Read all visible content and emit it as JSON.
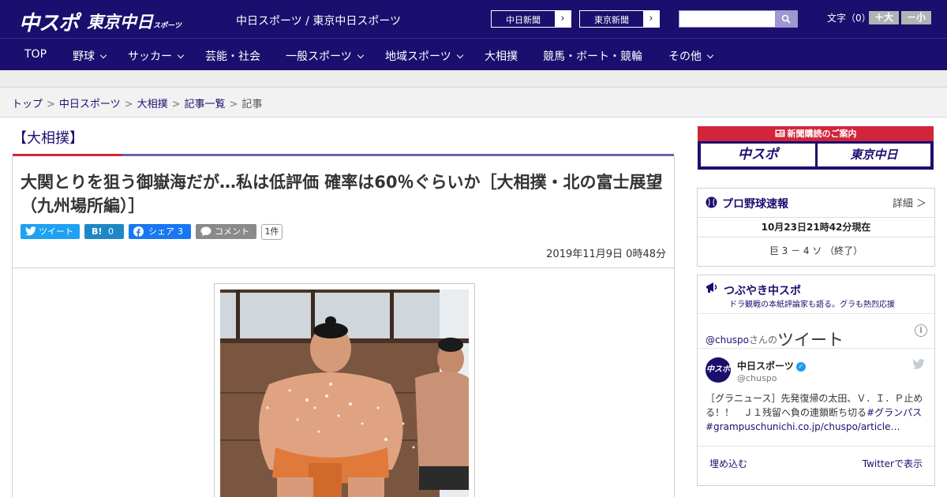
{
  "header": {
    "logo_chuspo": "中スポ",
    "logo_tokyo": "東京中日",
    "logo_tokyo_small": "スポーツ",
    "site_line": "中日スポーツ / 東京中日スポーツ",
    "buttons": [
      {
        "label": "中日新聞"
      },
      {
        "label": "東京新聞"
      }
    ],
    "search_placeholder": "",
    "font_size_label": "文字（0）",
    "font_plus": "＋大",
    "font_minus": "－小"
  },
  "nav": [
    {
      "label": "TOP",
      "dropdown": false
    },
    {
      "label": "野球",
      "dropdown": true
    },
    {
      "label": "サッカー",
      "dropdown": true
    },
    {
      "label": "芸能・社会",
      "dropdown": false
    },
    {
      "label": "一般スポーツ",
      "dropdown": true
    },
    {
      "label": "地域スポーツ",
      "dropdown": true
    },
    {
      "label": "大相撲",
      "dropdown": false
    },
    {
      "label": "競馬・ボート・競輪",
      "dropdown": false
    },
    {
      "label": "その他",
      "dropdown": true
    }
  ],
  "breadcrumb": [
    "トップ",
    "中日スポーツ",
    "大相撲",
    "記事一覧",
    "記事"
  ],
  "article": {
    "category": "【大相撲】",
    "headline": "大関とりを狙う御嶽海だが…私は低評価 確率は60％ぐらいか［大相撲・北の富士展望（九州場所編）］",
    "share": {
      "tweet": "ツイート",
      "hatena_label": "B!",
      "hatena_count": "0",
      "facebook": "シェア",
      "facebook_count": "3",
      "comment": "コメント",
      "comment_count": "1件"
    },
    "date": "2019年11月9日 0時48分"
  },
  "sidebar": {
    "subscribe_title": "新聞購読のご案内",
    "subscribe_chuspo": "中スポ",
    "subscribe_tokyo": "東京中日",
    "baseball": {
      "title": "プロ野球速報",
      "detail": "詳細 ＞",
      "time": "10月23日21時42分現在",
      "score": "巨 3 － 4 ソ （終了）"
    },
    "tweets": {
      "title": "つぶやき中スポ",
      "subtitle": "ドラ観戦の本紙評論家も語る。グラも熱烈応援",
      "handle_link": "@chuspo",
      "handle_suffix": "さんの",
      "heading": "ツイート",
      "avatar_text": "中スポ",
      "account_name": "中日スポーツ",
      "account_handle": "@chuspo",
      "text_main": "［グラニュース］先発復帰の太田、Ｖ．Ｉ．Ｐ止める！！　Ｊ１残留へ負の連鎖断ち切る",
      "hashtag": "#グランパス",
      "link": "#grampuschunichi.co.jp/chuspo/article…",
      "embed": "埋め込む",
      "view_on_twitter": "Twitterで表示"
    }
  },
  "colors": {
    "brand_navy": "#1a0f6e",
    "accent_red": "#d2243b",
    "twitter": "#1da1f2",
    "hatena": "#1e88c7",
    "facebook": "#1877f2",
    "comment_gray": "#8a8a8a"
  }
}
